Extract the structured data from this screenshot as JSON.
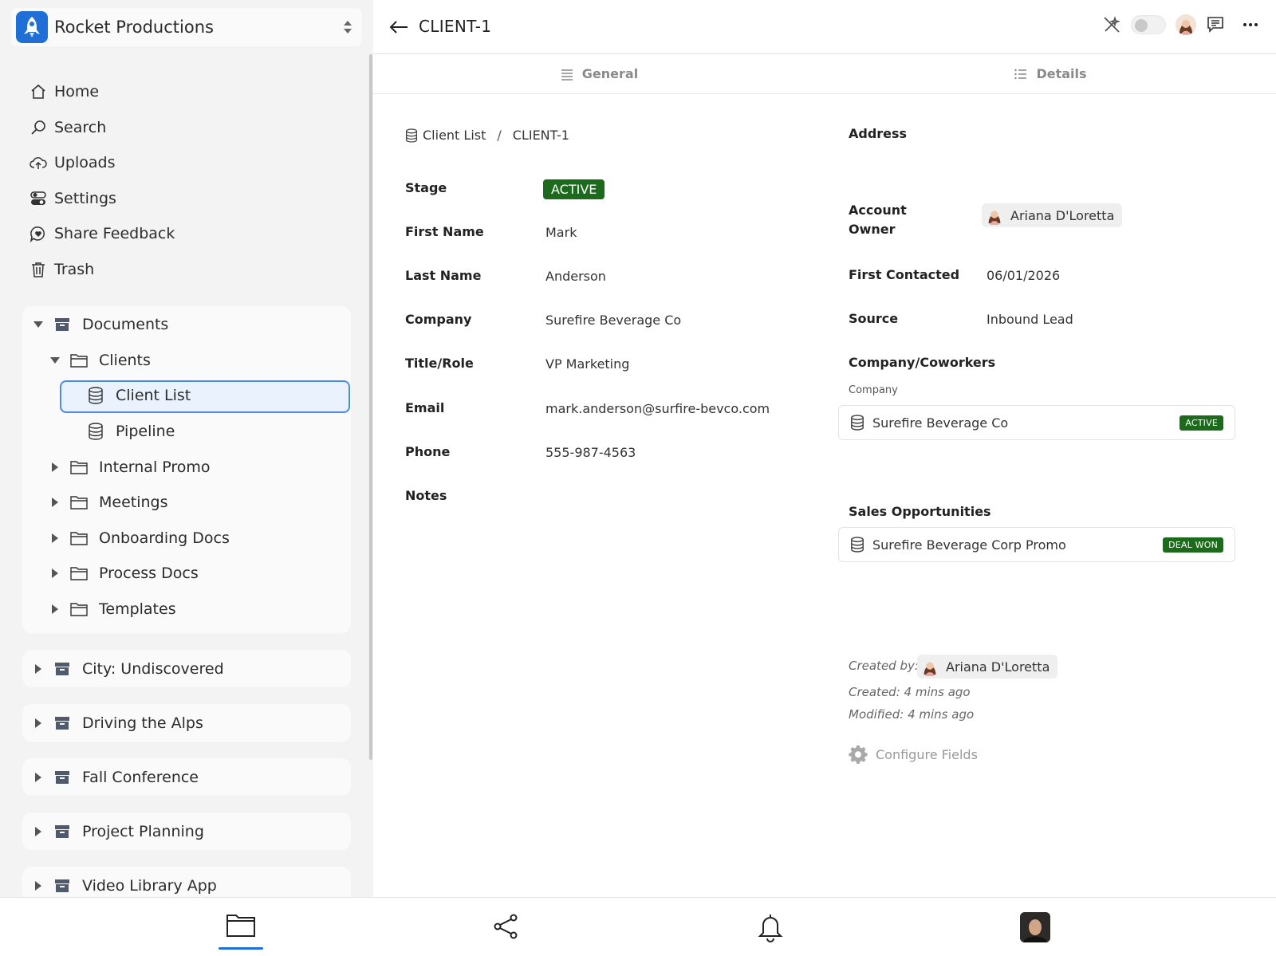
{
  "workspace": {
    "name": "Rocket Productions"
  },
  "nav": [
    {
      "label": "Home",
      "icon": "home-icon"
    },
    {
      "label": "Search",
      "icon": "search-icon"
    },
    {
      "label": "Uploads",
      "icon": "cloud-upload-icon"
    },
    {
      "label": "Settings",
      "icon": "toggles-icon"
    },
    {
      "label": "Share Feedback",
      "icon": "heart-chat-icon"
    },
    {
      "label": "Trash",
      "icon": "trash-icon"
    }
  ],
  "tree": {
    "root": "Documents",
    "clients": "Clients",
    "client_list": "Client List",
    "pipeline": "Pipeline",
    "folders": [
      "Internal Promo",
      "Meetings",
      "Onboarding Docs",
      "Process Docs",
      "Templates"
    ]
  },
  "collapsed_sections": [
    "City: Undiscovered",
    "Driving the Alps",
    "Fall Conference",
    "Project Planning",
    "Video Library App"
  ],
  "record": {
    "title": "CLIENT-1"
  },
  "tabs": [
    {
      "label": "General"
    },
    {
      "label": "Details"
    }
  ],
  "breadcrumb": {
    "parent": "Client List",
    "separator": "/",
    "current": "CLIENT-1"
  },
  "fields_left": {
    "stage_label": "Stage",
    "stage_value": "ACTIVE",
    "first_name_label": "First Name",
    "first_name_value": "Mark",
    "last_name_label": "Last Name",
    "last_name_value": "Anderson",
    "company_label": "Company",
    "company_value": "Surefire Beverage Co",
    "title_label": "Title/Role",
    "title_value": "VP Marketing",
    "email_label": "Email",
    "email_value": "mark.anderson@surfire-bevco.com",
    "phone_label": "Phone",
    "phone_value": "555-987-4563",
    "notes_label": "Notes"
  },
  "fields_right": {
    "address_label": "Address",
    "account_owner_label_1": "Account",
    "account_owner_label_2": "Owner",
    "account_owner_value": "Ariana D'Loretta",
    "first_contacted_label": "First Contacted",
    "first_contacted_value": "06/01/2026",
    "source_label": "Source",
    "source_value": "Inbound Lead",
    "coworkers_label": "Company/Coworkers",
    "company_sub_label": "Company",
    "company_link": {
      "name": "Surefire Beverage Co",
      "status": "ACTIVE"
    },
    "sales_label": "Sales Opportunities",
    "sales_link": {
      "name": "Surefire Beverage Corp Promo",
      "status": "DEAL WON"
    }
  },
  "meta": {
    "created_by_label": "Created by:",
    "created_by_user": "Ariana D'Loretta",
    "created": "Created: 4 mins ago",
    "modified": "Modified: 4 mins ago",
    "configure": "Configure Fields"
  },
  "colors": {
    "accent": "#1f6fd6",
    "status_green": "#1c6b1c",
    "selection_border": "#4a8ae8"
  },
  "bottom_nav": [
    {
      "icon": "folder-icon",
      "active": true
    },
    {
      "icon": "share-icon",
      "active": false
    },
    {
      "icon": "bell-icon",
      "active": false
    },
    {
      "icon": "user-avatar",
      "active": false
    }
  ]
}
